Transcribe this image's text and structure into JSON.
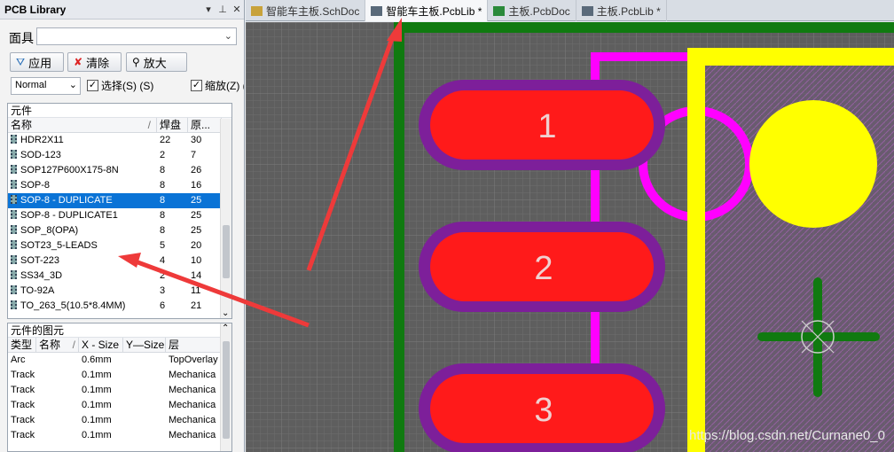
{
  "panel": {
    "title": "PCB Library",
    "pin": "▾ ⊥ ✕",
    "mask_label": "面具",
    "buttons": {
      "apply": "应用",
      "clear": "清除",
      "zoom": "放大"
    },
    "mode_select": "Normal",
    "check_select": "选择(S) (S)",
    "check_zoom": "缩放(Z) (Z)",
    "components": {
      "group_title": "元件",
      "col_name": "名称",
      "col_pads": "焊盘",
      "col_prims": "原...",
      "rows": [
        [
          "HDR2X11",
          "22",
          "30"
        ],
        [
          "SOD-123",
          "2",
          "7"
        ],
        [
          "SOP127P600X175-8N",
          "8",
          "26"
        ],
        [
          "SOP-8",
          "8",
          "16"
        ],
        [
          "SOP-8 - DUPLICATE",
          "8",
          "25"
        ],
        [
          "SOP-8 - DUPLICATE1",
          "8",
          "25"
        ],
        [
          "SOP_8(OPA)",
          "8",
          "25"
        ],
        [
          "SOT23_5-LEADS",
          "5",
          "20"
        ],
        [
          "SOT-223",
          "4",
          "10"
        ],
        [
          "SS34_3D",
          "2",
          "14"
        ],
        [
          "TO-92A",
          "3",
          "11"
        ],
        [
          "TO_263_5(10.5*8.4MM)",
          "6",
          "21"
        ]
      ],
      "selected_index": 4
    },
    "primitives": {
      "group_title": "元件的图元",
      "col_type": "类型",
      "col_name": "名称",
      "col_xsize": "X - Size",
      "col_ysize": "Y—Size",
      "col_layer": "层",
      "rows": [
        [
          "Arc",
          "",
          "0.6mm",
          "",
          "TopOverlay"
        ],
        [
          "Track",
          "",
          "0.1mm",
          "",
          "Mechanica"
        ],
        [
          "Track",
          "",
          "0.1mm",
          "",
          "Mechanica"
        ],
        [
          "Track",
          "",
          "0.1mm",
          "",
          "Mechanica"
        ],
        [
          "Track",
          "",
          "0.1mm",
          "",
          "Mechanica"
        ],
        [
          "Track",
          "",
          "0.1mm",
          "",
          "Mechanica"
        ]
      ]
    }
  },
  "tabs": [
    {
      "label": "智能车主板.SchDoc",
      "active": false
    },
    {
      "label": "智能车主板.PcbLib *",
      "active": true
    },
    {
      "label": "主板.PcbDoc",
      "active": false
    },
    {
      "label": "主板.PcbLib *",
      "active": false
    }
  ],
  "pads": [
    "1",
    "2",
    "3"
  ],
  "watermark": "https://blog.csdn.net/Curnane0_0",
  "colors": {
    "pad": "#ff1a1a",
    "pad_ring": "#7d1f9a",
    "board_edge": "#107a10",
    "overlay": "#ffff00",
    "magenta": "#ff00ff",
    "grid_bg": "#606060",
    "selection": "#0a73d6",
    "arrow": "#ee3a3a"
  }
}
